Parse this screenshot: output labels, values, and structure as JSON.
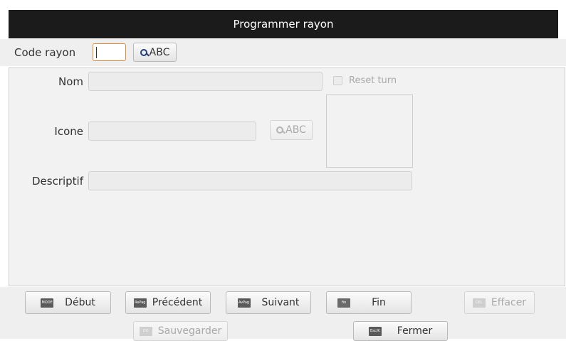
{
  "title": "Programmer rayon",
  "code_rayon": {
    "label": "Code rayon",
    "value": "",
    "search_label": "ABC"
  },
  "form": {
    "nom_label": "Nom",
    "nom_value": "",
    "reset_turn_label": "Reset turn",
    "icone_label": "Icone",
    "icone_value": "",
    "icone_search_label": "ABC",
    "descriptif_label": "Descriptif",
    "descriptif_value": ""
  },
  "buttons": {
    "debut": {
      "label": "Début",
      "badge": "MODE"
    },
    "precedent": {
      "label": "Précédent",
      "badge": "RePag"
    },
    "suivant": {
      "label": "Suivant",
      "badge": "AvPag"
    },
    "fin": {
      "label": "Fin",
      "badge": "fin"
    },
    "effacer": {
      "label": "Effacer",
      "badge": "DEL"
    },
    "sauvegarder": {
      "label": "Sauvegarder",
      "badge": "DO"
    },
    "fermer": {
      "label": "Fermer",
      "badge": "Esc/K"
    }
  },
  "colors": {
    "titlebar": "#1b1b1b",
    "focus_border": "#e08a3a",
    "search_icon": "#1f3f78"
  }
}
